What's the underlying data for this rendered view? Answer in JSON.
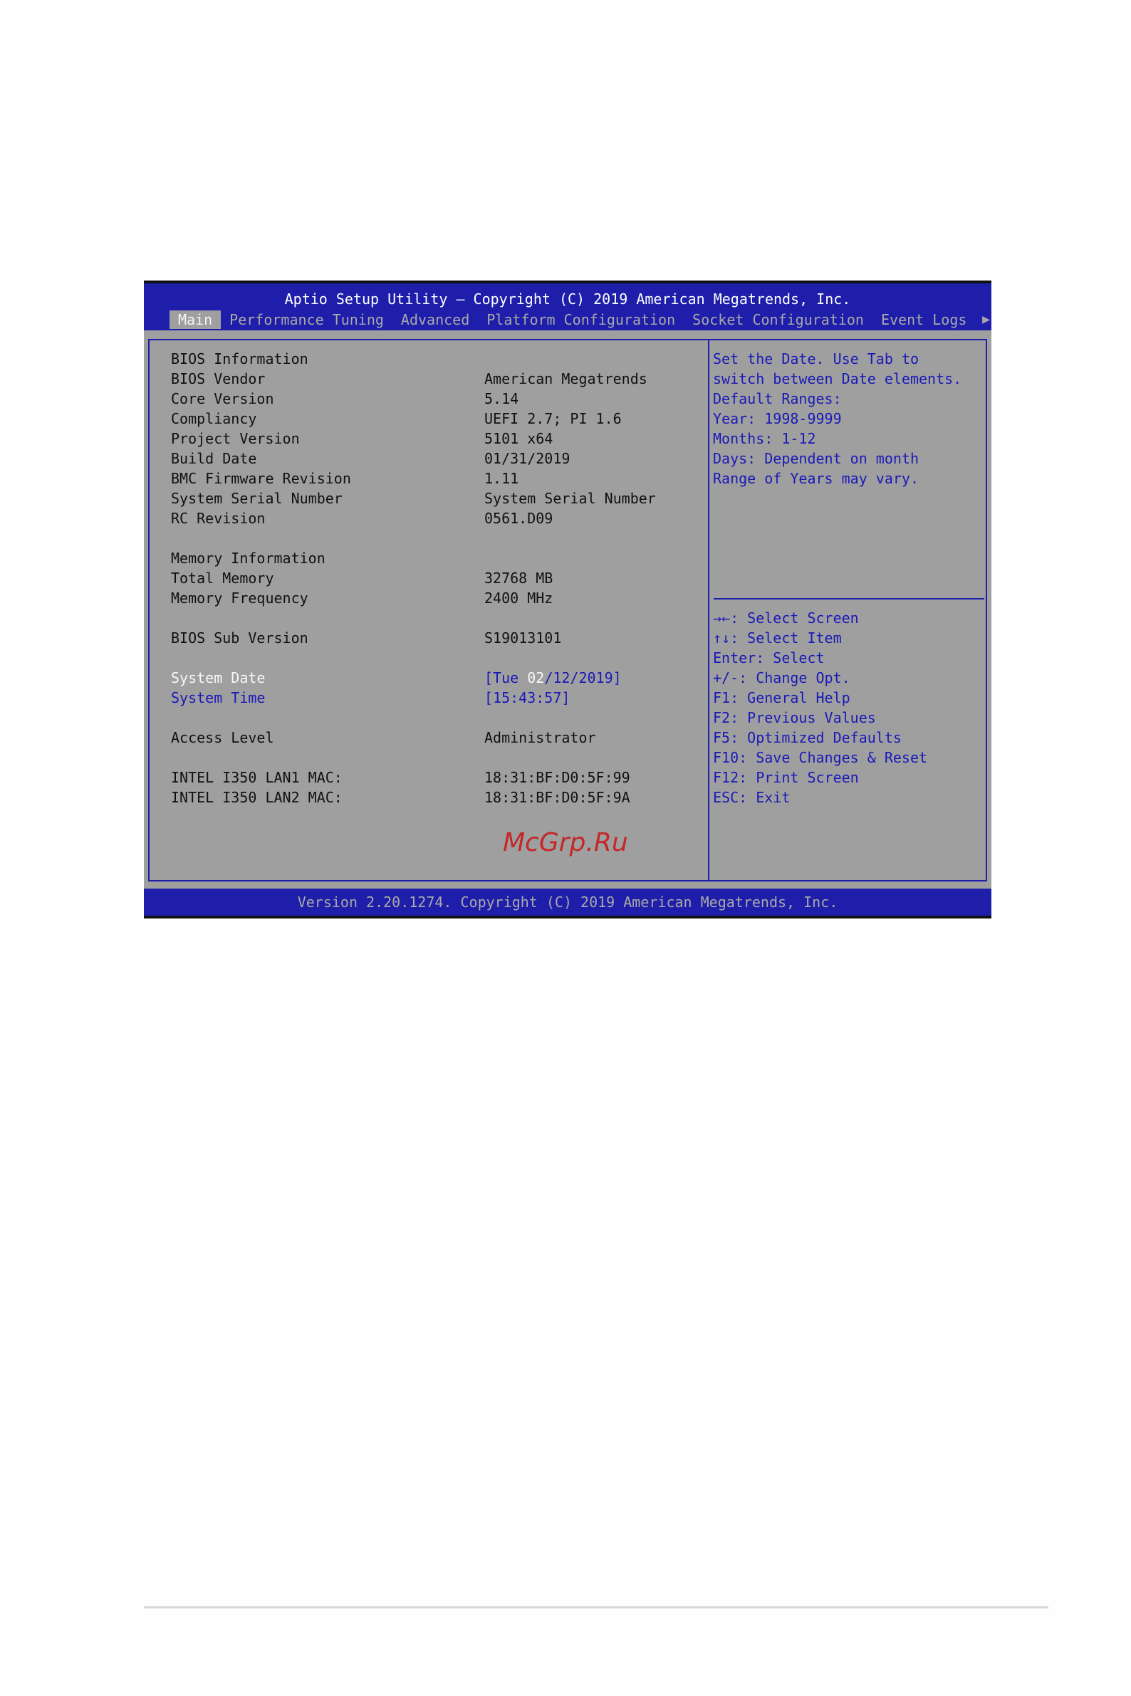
{
  "header": {
    "title": "Aptio Setup Utility – Copyright (C) 2019 American Megatrends, Inc.",
    "tabs": [
      "Main",
      "Performance Tuning",
      "Advanced",
      "Platform Configuration",
      "Socket Configuration",
      "Event Logs"
    ],
    "active_tab": "Main",
    "more_tabs_icon": "right-arrow-icon"
  },
  "main": {
    "bios_info_heading": "BIOS Information",
    "bios_rows": [
      {
        "label": "BIOS Vendor",
        "value": "American Megatrends"
      },
      {
        "label": "Core Version",
        "value": "5.14"
      },
      {
        "label": "Compliancy",
        "value": "UEFI 2.7; PI 1.6"
      },
      {
        "label": "Project Version",
        "value": "5101 x64"
      },
      {
        "label": "Build Date",
        "value": "01/31/2019"
      },
      {
        "label": "BMC Firmware Revision",
        "value": "1.11"
      },
      {
        "label": "System Serial Number",
        "value": "System Serial Number"
      },
      {
        "label": "RC Revision",
        "value": "0561.D09"
      }
    ],
    "memory_heading": "Memory Information",
    "memory_rows": [
      {
        "label": "Total Memory",
        "value": "32768 MB"
      },
      {
        "label": "Memory Frequency",
        "value": "2400 MHz"
      }
    ],
    "sub_version": {
      "label": "BIOS Sub Version",
      "value": "S19013101"
    },
    "system_date": {
      "label": "System Date",
      "prefix": "[Tue ",
      "highlight": "02",
      "suffix": "/12/2019]"
    },
    "system_time": {
      "label": "System Time",
      "value": "[15:43:57]"
    },
    "access_level": {
      "label": "Access Level",
      "value": "Administrator"
    },
    "mac_rows": [
      {
        "label": "INTEL I350 LAN1 MAC:",
        "value": "18:31:BF:D0:5F:99"
      },
      {
        "label": "INTEL I350 LAN2 MAC:",
        "value": "18:31:BF:D0:5F:9A"
      }
    ]
  },
  "help": {
    "description": [
      "Set the Date. Use Tab to",
      "switch between Date elements.",
      "Default Ranges:",
      "Year: 1998-9999",
      "Months: 1-12",
      "Days: Dependent on month",
      "Range of Years may vary."
    ],
    "keys": [
      "→←: Select Screen",
      "↑↓: Select Item",
      "Enter: Select",
      "+/-: Change Opt.",
      "F1: General Help",
      "F2: Previous Values",
      "F5: Optimized Defaults",
      "F10: Save Changes & Reset",
      "F12: Print Screen",
      "ESC: Exit"
    ]
  },
  "watermark": "McGrp.Ru",
  "footer": "Version 2.20.1274. Copyright (C) 2019 American Megatrends, Inc.",
  "colors": {
    "bios_blue": "#1e1eaa",
    "panel_gray": "#9f9f9f",
    "highlight_white": "#f6f6f6",
    "watermark_red": "#c42828"
  }
}
